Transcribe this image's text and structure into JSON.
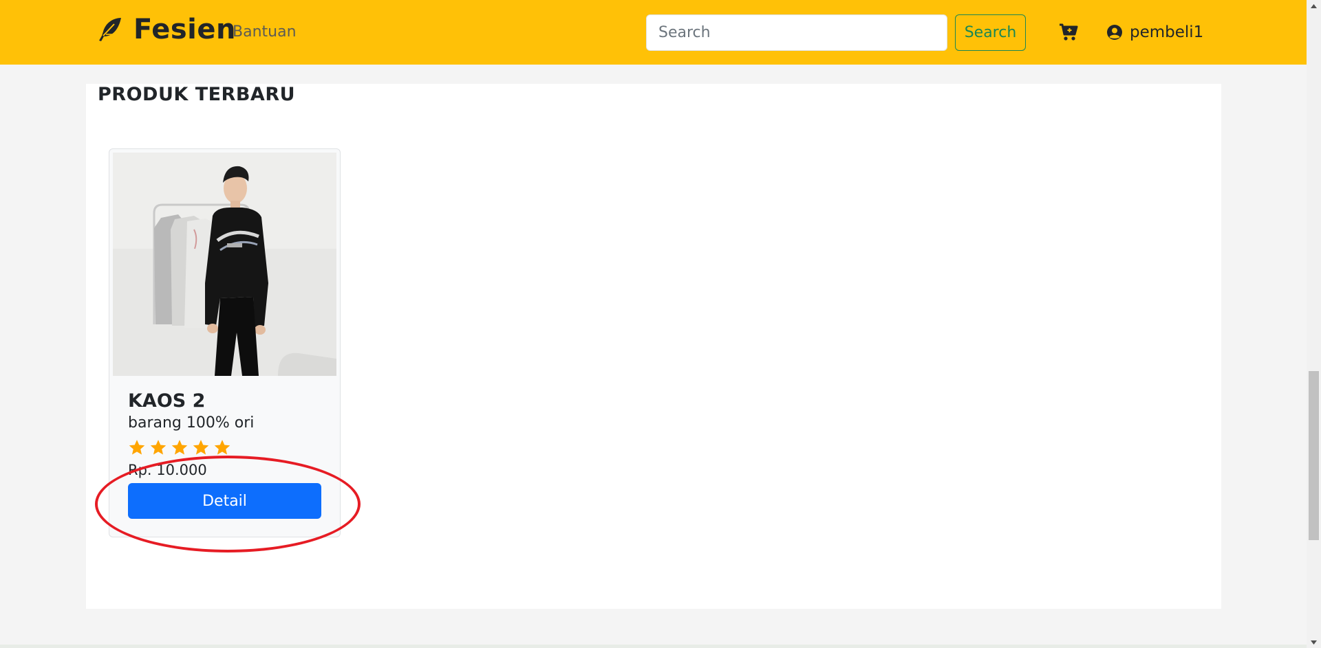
{
  "navbar": {
    "brand": "Fesien",
    "brand_icon": "feather-icon",
    "help_link": "Bantuan",
    "search_placeholder": "Search",
    "search_button": "Search",
    "cart_icon": "cart-plus-icon",
    "user_icon": "user-circle-icon",
    "username": "pembeli1",
    "background_color": "#ffc107"
  },
  "main": {
    "section_title": "PRODUK TERBARU",
    "products": [
      {
        "name": "KAOS 2",
        "description": "barang 100% ori",
        "rating": 5,
        "rating_max": 5,
        "price": "Rp. 10.000",
        "detail_button": "Detail",
        "image": "man-in-black-sweatshirt-photo"
      }
    ]
  },
  "colors": {
    "primary_button": "#0d6efd",
    "search_button": "#198754",
    "star": "#ffa500",
    "annotation": "#e61c24"
  }
}
